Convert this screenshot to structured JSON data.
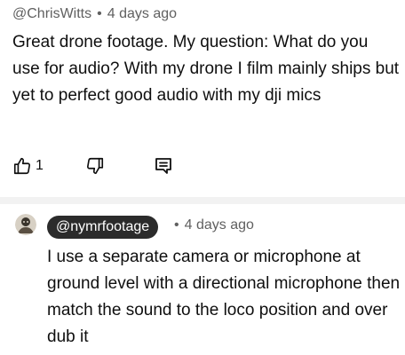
{
  "comment": {
    "author": "@ChrisWitts",
    "separator": "•",
    "time": "4 days ago",
    "text": "Great drone footage. My question: What do you use for audio? With my drone I film mainly ships but yet to perfect good audio with my dji mics",
    "like_count": "1"
  },
  "reply": {
    "author_badge": "@nymrfootage",
    "separator": "•",
    "time": "4 days ago",
    "text": "I use a separate camera or microphone at ground level with a directional microphone then match the sound to the loco position and over dub it"
  },
  "icons": {
    "like": "thumbs-up-icon",
    "dislike": "thumbs-down-icon",
    "reply": "reply-comment-icon",
    "avatar": "avatar"
  },
  "colors": {
    "secondary_text": "#606060",
    "badge_bg": "#2b2b2b",
    "divider": "#f2f2f2"
  }
}
